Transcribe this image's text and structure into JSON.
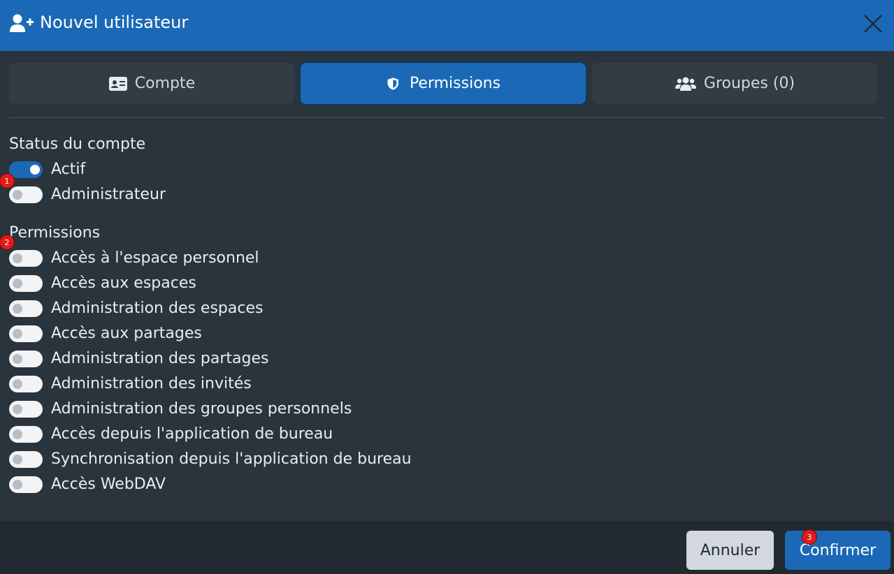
{
  "dialog": {
    "title": "Nouvel utilisateur",
    "header_icon": "user-plus-icon",
    "close_icon": "close-icon"
  },
  "tabs": [
    {
      "label": "Compte",
      "icon": "id-card-icon",
      "active": false
    },
    {
      "label": "Permissions",
      "icon": "shield-icon",
      "active": true
    },
    {
      "label": "Groupes (0)",
      "icon": "users-icon",
      "active": false
    }
  ],
  "status_section": {
    "title": "Status du compte",
    "items": [
      {
        "label": "Actif",
        "on": true
      },
      {
        "label": "Administrateur",
        "on": false
      }
    ]
  },
  "permissions_section": {
    "title": "Permissions",
    "items": [
      {
        "label": "Accès à l'espace personnel",
        "on": false
      },
      {
        "label": "Accès aux espaces",
        "on": false
      },
      {
        "label": "Administration des espaces",
        "on": false
      },
      {
        "label": "Accès aux partages",
        "on": false
      },
      {
        "label": "Administration des partages",
        "on": false
      },
      {
        "label": "Administration des invités",
        "on": false
      },
      {
        "label": "Administration des groupes personnels",
        "on": false
      },
      {
        "label": "Accès depuis l'application de bureau",
        "on": false
      },
      {
        "label": "Synchronisation depuis l'application de bureau",
        "on": false
      },
      {
        "label": "Accès WebDAV",
        "on": false
      }
    ]
  },
  "badges": [
    "1",
    "2",
    "3"
  ],
  "footer": {
    "cancel_label": "Annuler",
    "confirm_label": "Confirmer"
  },
  "colors": {
    "primary": "#1b69b6",
    "background": "#2a343d",
    "badge": "#e01b1b"
  }
}
